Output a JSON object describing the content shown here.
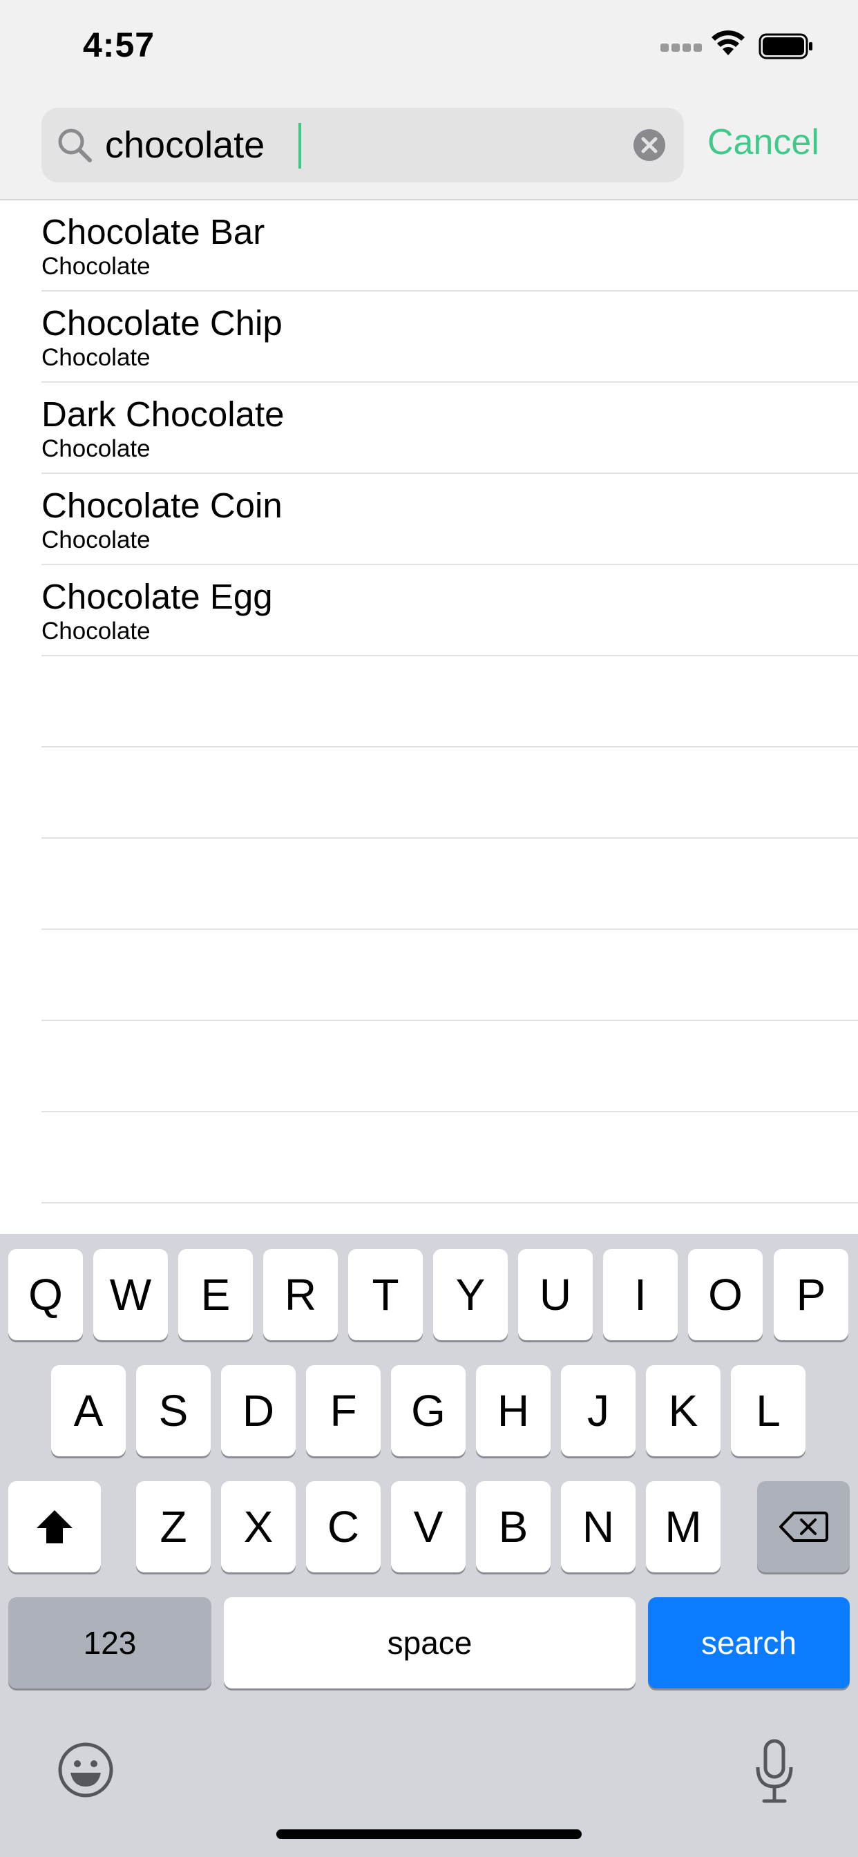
{
  "status_bar": {
    "time": "4:57"
  },
  "search": {
    "query": "chocolate",
    "cancel_label": "Cancel"
  },
  "results": [
    {
      "title": "Chocolate Bar",
      "subtitle": "Chocolate"
    },
    {
      "title": "Chocolate Chip",
      "subtitle": "Chocolate"
    },
    {
      "title": "Dark Chocolate",
      "subtitle": "Chocolate"
    },
    {
      "title": "Chocolate Coin",
      "subtitle": "Chocolate"
    },
    {
      "title": "Chocolate Egg",
      "subtitle": "Chocolate"
    }
  ],
  "keyboard": {
    "row1": [
      "Q",
      "W",
      "E",
      "R",
      "T",
      "Y",
      "U",
      "I",
      "O",
      "P"
    ],
    "row2": [
      "A",
      "S",
      "D",
      "F",
      "G",
      "H",
      "J",
      "K",
      "L"
    ],
    "row3": [
      "Z",
      "X",
      "C",
      "V",
      "B",
      "N",
      "M"
    ],
    "numbers_label": "123",
    "space_label": "space",
    "search_label": "search"
  },
  "colors": {
    "accent": "#3fc98a",
    "search_key": "#0b7bff"
  }
}
